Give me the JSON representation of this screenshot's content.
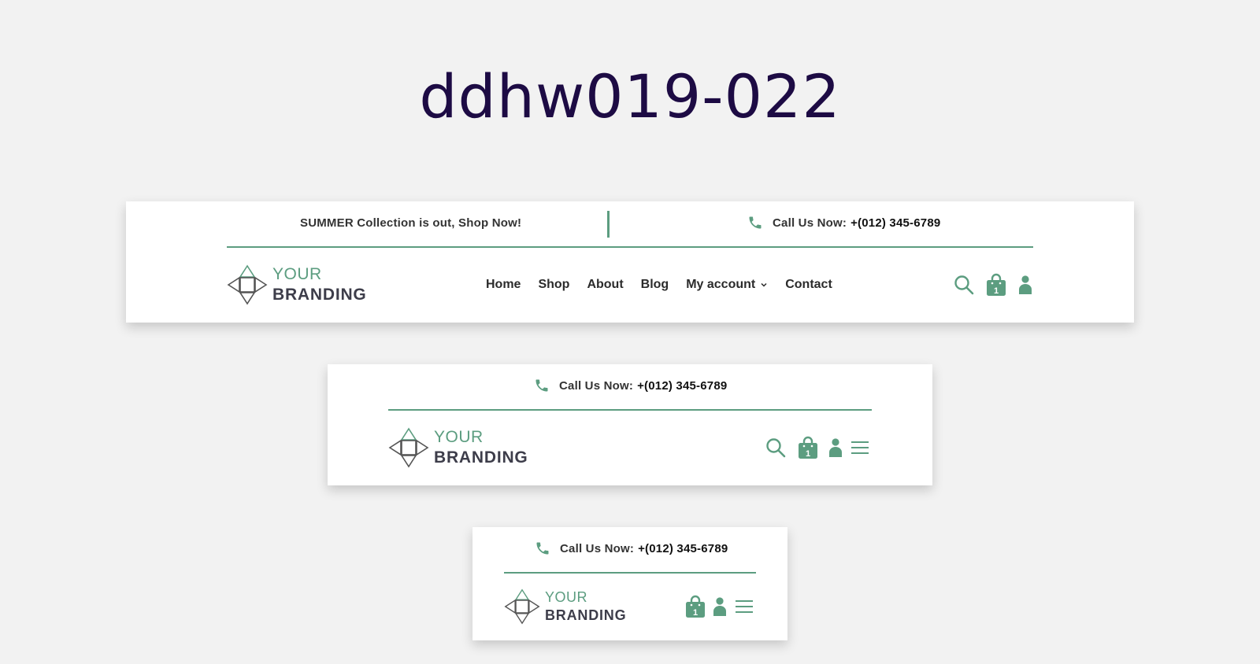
{
  "page": {
    "title": "ddhw019-022"
  },
  "colors": {
    "accent": "#5c9d80",
    "title": "#1d0b44",
    "text": "#2b2b2b",
    "background": "#f2f2f2"
  },
  "topbar": {
    "promo": "SUMMER Collection is out, Shop Now!",
    "call_label": "Call Us Now:",
    "phone": "+(012) 345-6789"
  },
  "brand": {
    "line1": "YOUR",
    "line2": "BRANDING"
  },
  "nav": {
    "items": [
      {
        "label": "Home"
      },
      {
        "label": "Shop"
      },
      {
        "label": "About"
      },
      {
        "label": "Blog"
      },
      {
        "label": "My account"
      },
      {
        "label": "Contact"
      }
    ]
  },
  "cart": {
    "count": "1"
  },
  "icons": [
    "phone-icon",
    "search-icon",
    "shopping-bag-icon",
    "user-icon",
    "hamburger-menu-icon",
    "chevron-down-icon"
  ]
}
